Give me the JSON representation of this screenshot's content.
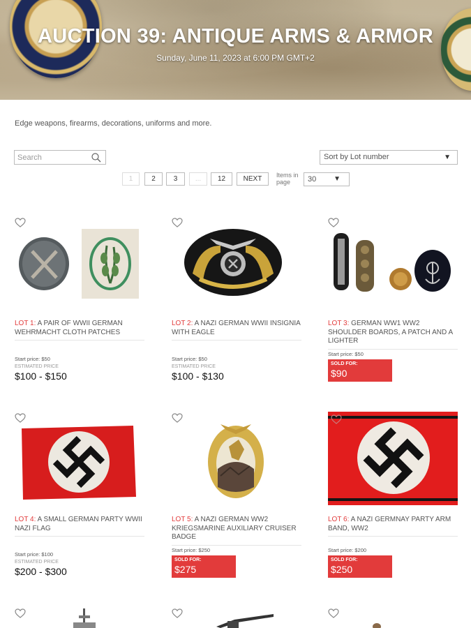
{
  "header": {
    "title": "AUCTION 39: ANTIQUE ARMS & ARMOR",
    "date": "Sunday, June 11, 2023 at 6:00 PM GMT+2"
  },
  "description": "Edge weapons, firearms, decorations, uniforms and more.",
  "search": {
    "placeholder": "Search"
  },
  "sort": {
    "selected": "Sort by Lot number"
  },
  "pagination": {
    "pages": [
      "1",
      "2",
      "3",
      "...",
      "12"
    ],
    "next_label": "NEXT",
    "items_label": "Items in page",
    "items_value": "30"
  },
  "colors": {
    "accent": "#e23b3b"
  },
  "lots": [
    {
      "lot_no": "LOT 1:",
      "title": "A PAIR OF WWII GERMAN WEHRMACHT CLOTH PATCHES",
      "start_price": "Start price: $50",
      "estimated_label": "ESTIMATED PRICE",
      "estimate": "$100 - $150"
    },
    {
      "lot_no": "LOT 2:",
      "title": "A NAZI GERMAN WWII INSIGNIA WITH EAGLE",
      "start_price": "Start price: $50",
      "estimated_label": "ESTIMATED PRICE",
      "estimate": "$100 - $130"
    },
    {
      "lot_no": "LOT 3:",
      "title": "GERMAN WW1 WW2 SHOULDER BOARDS, A PATCH AND A LIGHTER",
      "start_price": "Start price: $50",
      "sold_label": "SOLD FOR:",
      "sold_price": "$90"
    },
    {
      "lot_no": "LOT 4:",
      "title": "A SMALL GERMAN PARTY WWII NAZI FLAG",
      "start_price": "Start price: $100",
      "estimated_label": "ESTIMATED PRICE",
      "estimate": "$200 - $300"
    },
    {
      "lot_no": "LOT 5:",
      "title": "A NAZI GERMAN WW2 KRIEGSMARINE AUXILIARY CRUISER BADGE",
      "start_price": "Start price: $250",
      "sold_label": "SOLD FOR:",
      "sold_price": "$275"
    },
    {
      "lot_no": "LOT 6:",
      "title": "A NAZI GERMNAY PARTY ARM BAND, WW2",
      "start_price": "Start price: $200",
      "sold_label": "SOLD FOR:",
      "sold_price": "$250"
    }
  ]
}
